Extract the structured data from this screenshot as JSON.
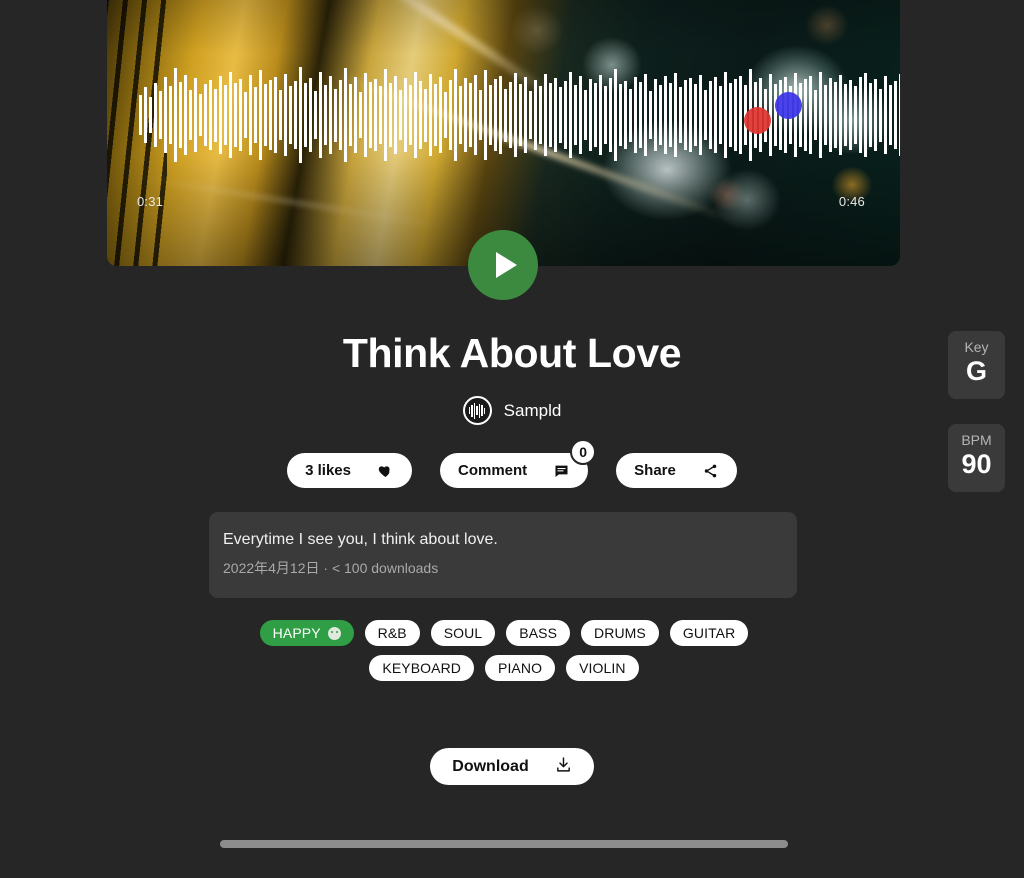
{
  "page": {
    "background_color": "#262626",
    "accent_color": "#3b8a3f",
    "tag_mood_color": "#2f9e44"
  },
  "player": {
    "name": "audio-player",
    "time_start": "0:31",
    "time_end": "0:46",
    "play_button_label": "play-icon",
    "waveform_heights": [
      38,
      52,
      34,
      60,
      46,
      72,
      54,
      88,
      62,
      76,
      48,
      70,
      40,
      58,
      66,
      50,
      74,
      56,
      82,
      60,
      68,
      44,
      76,
      52,
      84,
      58,
      66,
      72,
      48,
      78,
      54,
      64,
      90,
      60,
      70,
      46,
      82,
      56,
      74,
      50,
      66,
      88,
      58,
      72,
      44,
      80,
      62,
      68,
      54,
      86,
      60,
      74,
      48,
      70,
      56,
      82,
      64,
      50,
      78,
      58,
      72,
      44,
      66,
      86,
      54,
      70,
      60,
      76,
      48,
      84,
      56,
      68,
      74,
      50,
      62,
      80,
      58,
      72,
      46,
      66,
      54,
      78,
      60,
      70,
      52,
      64,
      82,
      56,
      74,
      48,
      68,
      60,
      76,
      54,
      70,
      86,
      58,
      64,
      50,
      72,
      62,
      78,
      46,
      68,
      56,
      74,
      60,
      80,
      52,
      66,
      70,
      58,
      76,
      48,
      64,
      72,
      54,
      82,
      60,
      68,
      74,
      56,
      86,
      62,
      70,
      50,
      78,
      58,
      66,
      72,
      54,
      80,
      60,
      68,
      74,
      48,
      82,
      56,
      70,
      62,
      76,
      58,
      66,
      54,
      72,
      80,
      60,
      68,
      50,
      74,
      56,
      64,
      78,
      58,
      70,
      62,
      66,
      54,
      72,
      60,
      68,
      52,
      74,
      58,
      64,
      70,
      56,
      62,
      66,
      54,
      60,
      68,
      52,
      58,
      64,
      50,
      56,
      62,
      48,
      54,
      58,
      46,
      52,
      44,
      50,
      40,
      46,
      36,
      42,
      32,
      38,
      28,
      32,
      24,
      20,
      16,
      12,
      9,
      7,
      5
    ],
    "markers": [
      {
        "name": "marker-red",
        "color": "#e0322e"
      },
      {
        "name": "marker-blue",
        "color": "#3b32e8"
      }
    ]
  },
  "track": {
    "title": "Think About Love",
    "artist": "Sampld",
    "description": "Everytime I see you, I think about love.",
    "meta": "2022年4月12日 · < 100 downloads"
  },
  "actions": {
    "likes_label": "3 likes",
    "comment_label": "Comment",
    "comment_count": "0",
    "share_label": "Share"
  },
  "tags": [
    {
      "label": "HAPPY",
      "mood": true
    },
    {
      "label": "R&B",
      "mood": false
    },
    {
      "label": "SOUL",
      "mood": false
    },
    {
      "label": "BASS",
      "mood": false
    },
    {
      "label": "DRUMS",
      "mood": false
    },
    {
      "label": "GUITAR",
      "mood": false
    },
    {
      "label": "KEYBOARD",
      "mood": false
    },
    {
      "label": "PIANO",
      "mood": false
    },
    {
      "label": "VIOLIN",
      "mood": false
    }
  ],
  "download": {
    "label": "Download"
  },
  "meta_cards": {
    "key_label": "Key",
    "key_value": "G",
    "bpm_label": "BPM",
    "bpm_value": "90"
  }
}
